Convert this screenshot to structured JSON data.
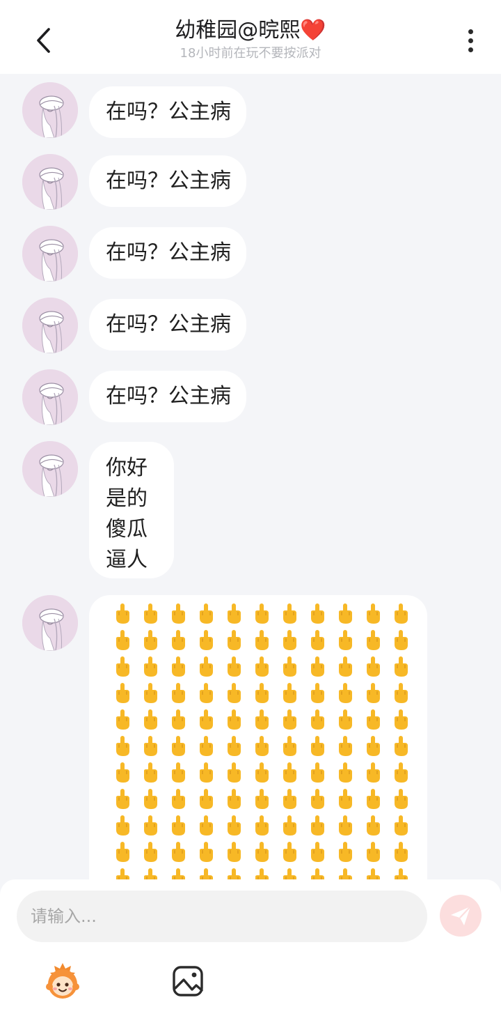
{
  "header": {
    "title": "幼稚园@晥熙❤️",
    "subtitle": "18小时前在玩不要按派对"
  },
  "messages": [
    {
      "text": "在吗？公主病"
    },
    {
      "text": "在吗？公主病"
    },
    {
      "text": "在吗？公主病"
    },
    {
      "text": "在吗？公主病"
    },
    {
      "text": "在吗？公主病"
    },
    {
      "lines": [
        "你好",
        "是的",
        "傻瓜",
        "逼人"
      ]
    },
    {
      "emoji": "🖕",
      "emoji_name": "middle-finger-emoji",
      "columns": 11
    }
  ],
  "composer": {
    "placeholder": "请输入..."
  },
  "colors": {
    "header_bg": "#ffffff",
    "chat_bg": "#f4f5f8",
    "bubble_bg": "#ffffff",
    "send_button": "#fcdede",
    "emoji_yellow": "#f7b826"
  },
  "icons": [
    "back-arrow-icon",
    "more-dots-icon",
    "send-icon",
    "sticker-mascot-icon",
    "image-icon"
  ]
}
